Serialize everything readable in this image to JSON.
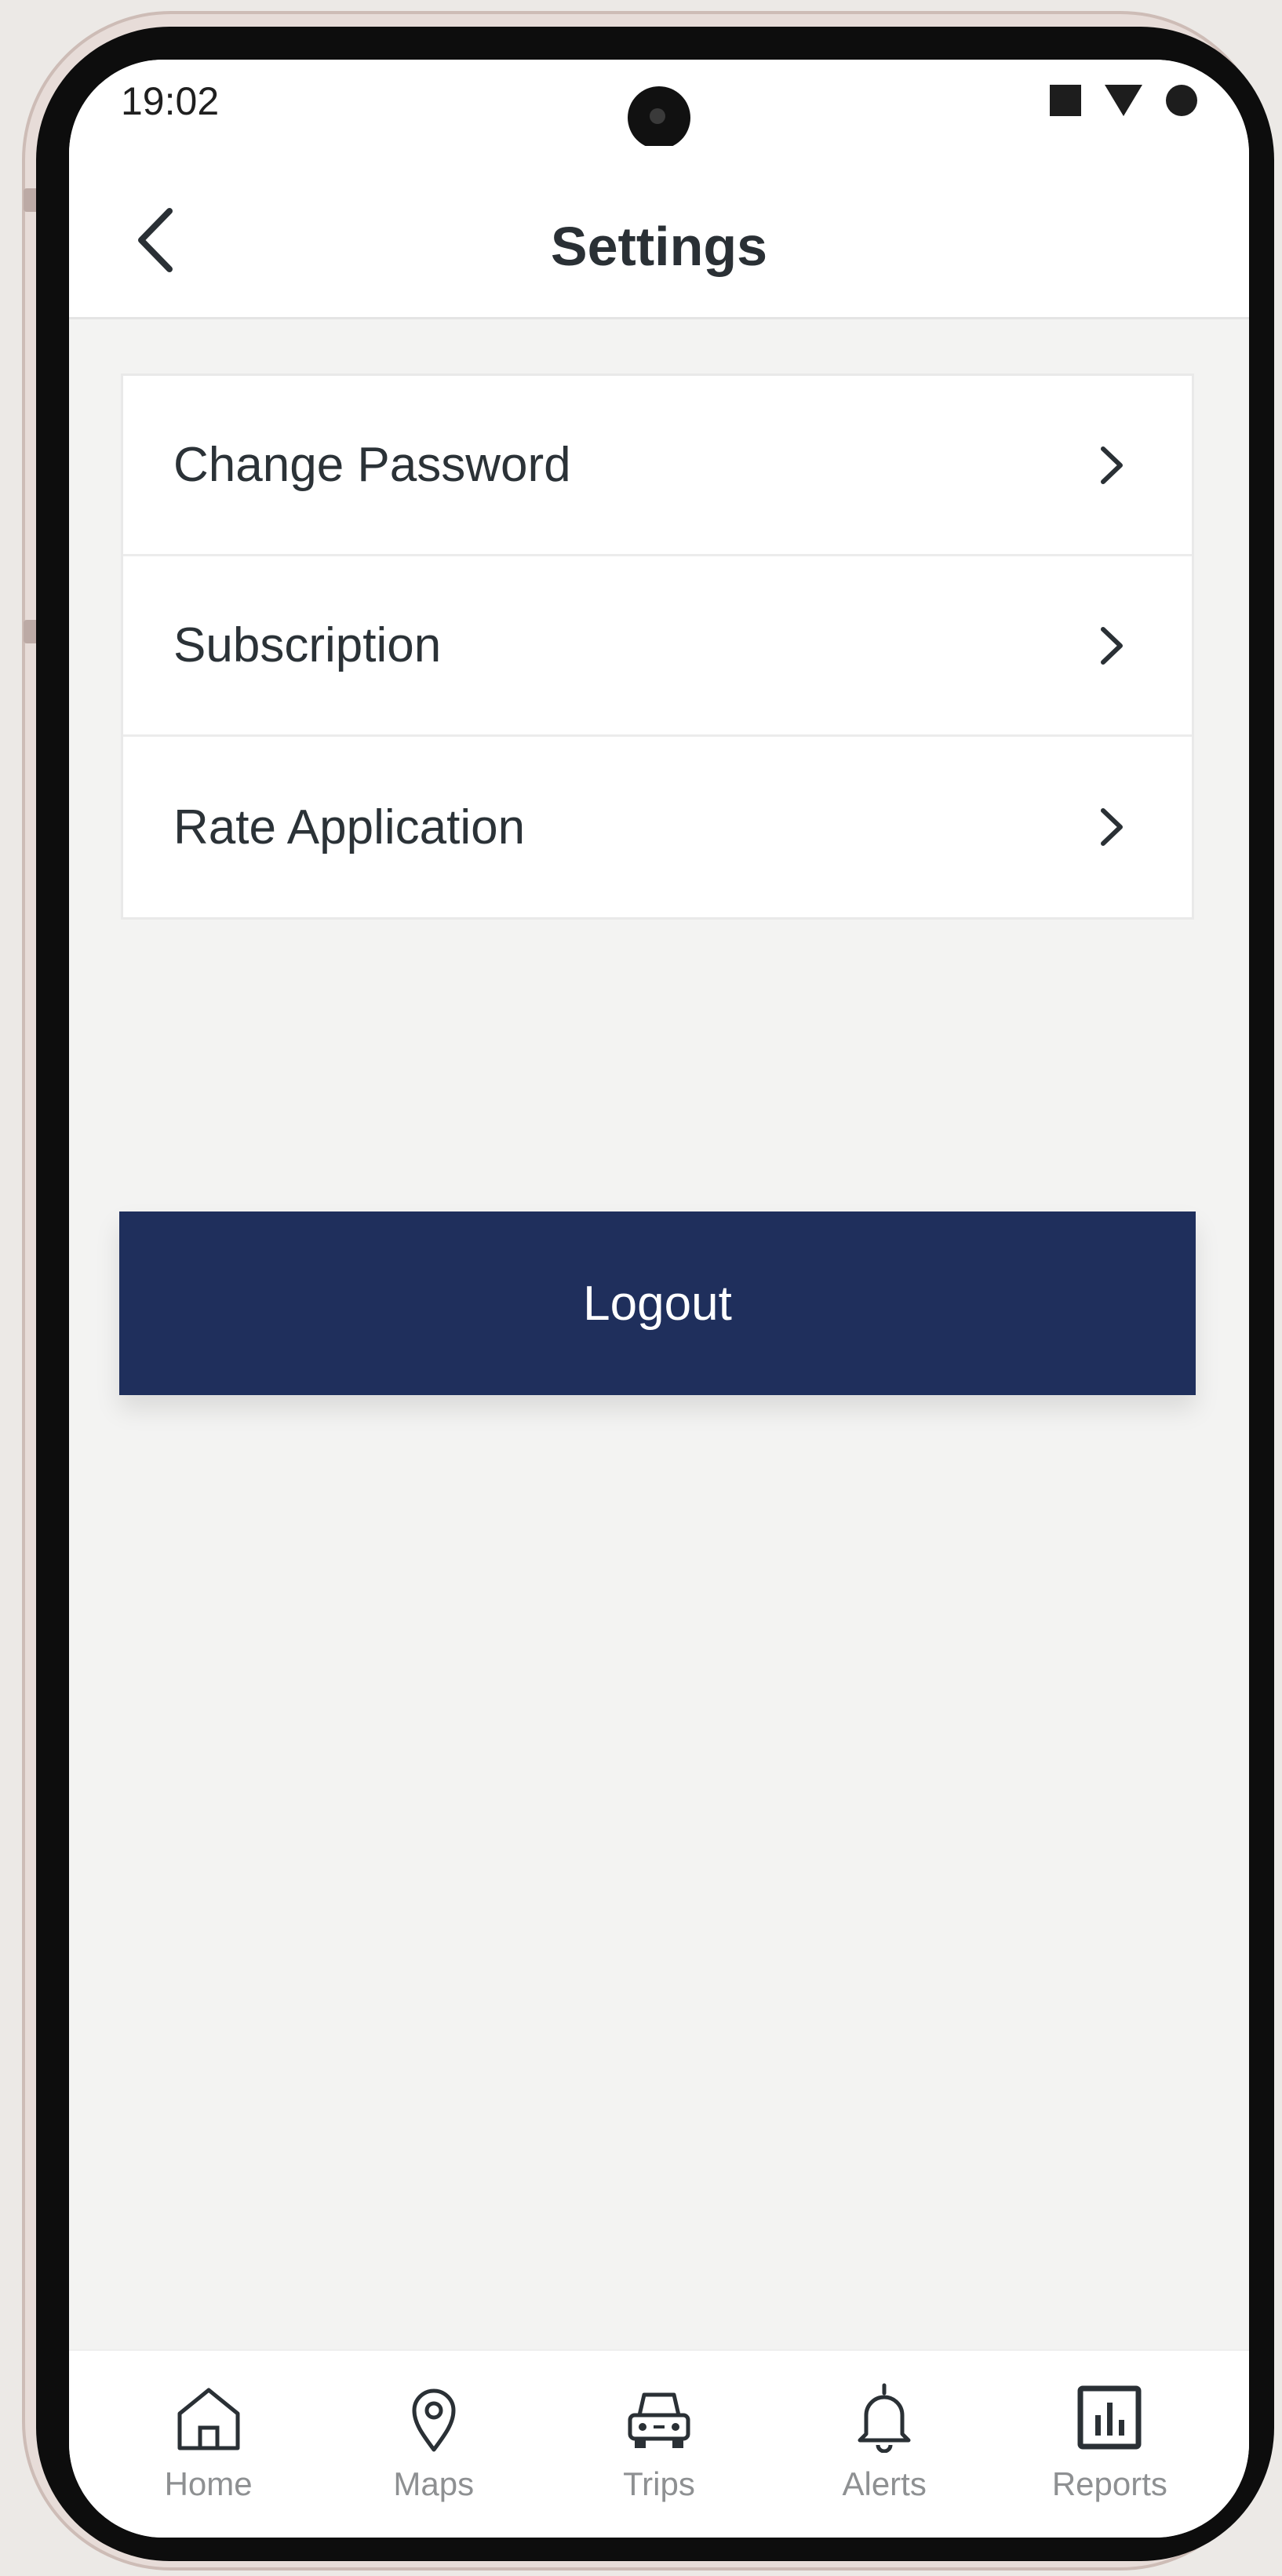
{
  "status_bar": {
    "time": "19:02"
  },
  "header": {
    "title": "Settings",
    "back_icon": "chevron-left-icon"
  },
  "settings": {
    "items": [
      {
        "label": "Change Password",
        "icon": "chevron-right-icon"
      },
      {
        "label": "Subscription",
        "icon": "chevron-right-icon"
      },
      {
        "label": "Rate Application",
        "icon": "chevron-right-icon"
      }
    ]
  },
  "logout": {
    "label": "Logout",
    "color": "#1f2f5c"
  },
  "bottom_nav": {
    "items": [
      {
        "label": "Home",
        "icon": "home-icon"
      },
      {
        "label": "Maps",
        "icon": "map-pin-icon"
      },
      {
        "label": "Trips",
        "icon": "car-icon"
      },
      {
        "label": "Alerts",
        "icon": "bell-icon"
      },
      {
        "label": "Reports",
        "icon": "bar-chart-icon"
      }
    ]
  }
}
